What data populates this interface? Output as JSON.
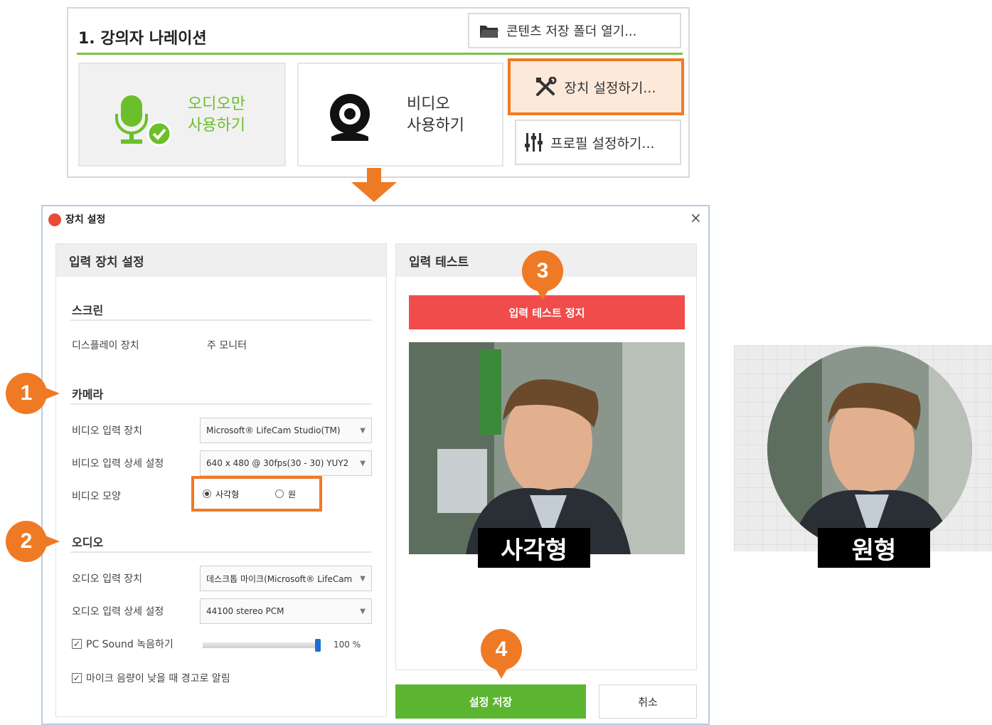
{
  "top_panel": {
    "section_title": "1. 강의자 나레이션",
    "open_folder_label": "콘텐츠 저장 폴더 열기...",
    "audio_only_line1": "오디오만",
    "audio_only_line2": "사용하기",
    "video_line1": "비디오",
    "video_line2": "사용하기",
    "device_settings_label": "장치 설정하기...",
    "profile_settings_label": "프로필 설정하기..."
  },
  "dialog": {
    "title": "장치 설정",
    "close_glyph": "×",
    "input_settings_head": "입력 장치 설정",
    "screen_head": "스크린",
    "display_device_label": "디스플레이 장치",
    "display_device_value": "주 모니터",
    "camera_head": "카메라",
    "video_input_device_label": "비디오 입력 장치",
    "video_input_device_value": "Microsoft® LifeCam Studio(TM)",
    "video_input_detail_label": "비디오 입력 상세 설정",
    "video_input_detail_value": "640 x 480 @ 30fps(30 - 30) YUY2",
    "video_shape_label": "비디오 모양",
    "shape_square": "사각형",
    "shape_circle": "원",
    "audio_head": "오디오",
    "audio_input_device_label": "오디오 입력 장치",
    "audio_input_device_value": "데스크톱 마이크(Microsoft® LifeCam",
    "audio_input_detail_label": "오디오 입력 상세 설정",
    "audio_input_detail_value": "44100 stereo PCM",
    "pc_sound_label": "PC Sound 녹음하기",
    "pc_sound_volume": "100 %",
    "pc_sound_level": 1.0,
    "mic_warning_label": "마이크 음량이 낮을 때 경고로 알림",
    "input_test_head": "입력 테스트",
    "stop_test_label": "입력 테스트 정지",
    "save_label": "설정 저장",
    "cancel_label": "취소"
  },
  "callouts": {
    "one": "1",
    "two": "2",
    "three": "3",
    "four": "4"
  },
  "captions": {
    "square": "사각형",
    "circle": "원형"
  },
  "colors": {
    "accent_orange": "#ef7a25",
    "green": "#5cb531",
    "red": "#f04c4c"
  }
}
